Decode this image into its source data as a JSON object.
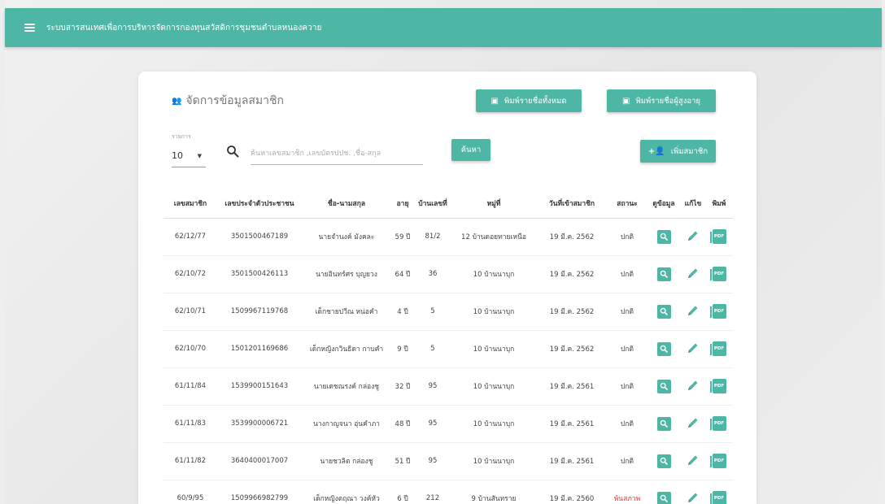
{
  "app": {
    "title": "ระบบสารสนเทศเพื่อการบริหารจัดการกองทุนสวัสดิการชุมชนตำบลหนองควาย"
  },
  "card": {
    "title": "จัดการข้อมูลสมาชิก",
    "print_all_label": "พิมพ์รายชื่อทั้งหมด",
    "print_elder_label": "พิมพ์รายชื่อผู้สูงอายุ",
    "add_member_label": "เพิ่มสมาชิก",
    "search_label": "ค้นหา"
  },
  "rows_select": {
    "label": "รายการ",
    "value": "10"
  },
  "search": {
    "placeholder": "ค้นหาเลขสมาชิก ,เลขบัตรปปช. ,ชื่อ-สกุล"
  },
  "table": {
    "headers": [
      "เลขสมาชิก",
      "เลขประจำตัวประชาชน",
      "ชื่อ-นามสกุล",
      "อายุ",
      "บ้านเลขที่",
      "หมู่ที่",
      "วันที่เข้าสมาชิก",
      "สถานะ",
      "ดูข้อมูล",
      "แก้ไข",
      "พิมพ์"
    ],
    "rows": [
      {
        "member_id": "62/12/77",
        "citizen_id": "3501500467189",
        "name": "นายจำนงค์ มังคละ",
        "age": "59 ปี",
        "house_no": "81/2",
        "moo": "12 บ้านดอยทายเหนือ",
        "join_date": "19 มี.ค. 2562",
        "status": "ปกติ"
      },
      {
        "member_id": "62/10/72",
        "citizen_id": "3501500426113",
        "name": "นายอินทร์ศร บุญยวง",
        "age": "64 ปี",
        "house_no": "36",
        "moo": "10 บ้านนาบุก",
        "join_date": "19 มี.ค. 2562",
        "status": "ปกติ"
      },
      {
        "member_id": "62/10/71",
        "citizen_id": "1509967119768",
        "name": "เด็กชายปวีณ หน่อคำ",
        "age": "4 ปี",
        "house_no": "5",
        "moo": "10 บ้านนาบุก",
        "join_date": "19 มี.ค. 2562",
        "status": "ปกติ"
      },
      {
        "member_id": "62/10/70",
        "citizen_id": "1501201169686",
        "name": "เด็กหญิงกวินธิดา กาบคำ",
        "age": "9 ปี",
        "house_no": "5",
        "moo": "10 บ้านนาบุก",
        "join_date": "19 มี.ค. 2562",
        "status": "ปกติ"
      },
      {
        "member_id": "61/11/84",
        "citizen_id": "1539900151643",
        "name": "นายเดชณรงค์ กล่องชู",
        "age": "32 ปี",
        "house_no": "95",
        "moo": "10 บ้านนาบุก",
        "join_date": "19 มี.ค. 2561",
        "status": "ปกติ"
      },
      {
        "member_id": "61/11/83",
        "citizen_id": "3539900006721",
        "name": "นางกาญจนา อุ่นคำภา",
        "age": "48 ปี",
        "house_no": "95",
        "moo": "10 บ้านนาบุก",
        "join_date": "19 มี.ค. 2561",
        "status": "ปกติ"
      },
      {
        "member_id": "61/11/82",
        "citizen_id": "3640400017007",
        "name": "นายชวลิต กล่องชู",
        "age": "51 ปี",
        "house_no": "95",
        "moo": "10 บ้านนาบุก",
        "join_date": "19 มี.ค. 2561",
        "status": "ปกติ"
      },
      {
        "member_id": "60/9/95",
        "citizen_id": "1509966982799",
        "name": "เด็กหญิงตฤณา วงค์หัว",
        "age": "6 ปี",
        "house_no": "212",
        "moo": "9 บ้านสันทราย",
        "join_date": "19 มี.ค. 2560",
        "status": "พ้นสภาพ"
      }
    ]
  },
  "icons": {
    "menu": "menu-icon",
    "people": "people-icon",
    "print": "print-icon",
    "add_person": "add-person-icon",
    "search": "search-icon",
    "view": "magnify-icon",
    "edit": "pencil-icon",
    "pdf": "pdf-icon"
  },
  "pdf_badge_text": "PDF",
  "colors": {
    "primary": "#4db6a4",
    "status_inactive": "#e53935"
  }
}
